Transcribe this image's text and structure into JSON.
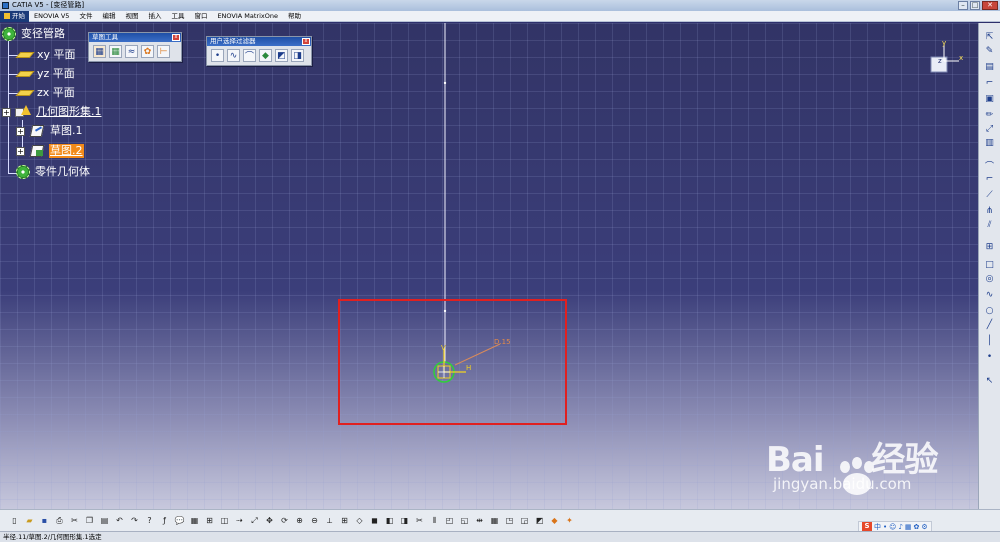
{
  "window": {
    "title": "CATIA V5 - [变径管路]",
    "min_label": "–",
    "max_label": "□",
    "close_label": "✕"
  },
  "menu": {
    "items": [
      {
        "label": "开始"
      },
      {
        "label": "ENOVIA V5"
      },
      {
        "label": "文件"
      },
      {
        "label": "编辑"
      },
      {
        "label": "视图"
      },
      {
        "label": "插入"
      },
      {
        "label": "工具"
      },
      {
        "label": "窗口"
      },
      {
        "label": "ENOVIA MatrixOne"
      },
      {
        "label": "帮助"
      }
    ]
  },
  "tree": {
    "root": "变径管路",
    "planes": [
      "xy 平面",
      "yz 平面",
      "zx 平面"
    ],
    "geoset": "几何图形集.1",
    "sketch1": "草图.1",
    "sketch2": "草图.2",
    "body": "零件几何体",
    "expander_label": "+"
  },
  "toolbars": {
    "sketch_tools": {
      "title": "草图工具",
      "close_label": "x"
    },
    "user_filter": {
      "title": "用户选择过滤器",
      "close_label": "x"
    }
  },
  "sketch": {
    "dimension_label": "D.15",
    "v_axis": "V",
    "h_axis": "H"
  },
  "compass": {
    "x": "x",
    "y": "y",
    "z": "z"
  },
  "status": {
    "text": "半径.11/草图.2/几何图形集.1选定"
  },
  "ime": {
    "s": "S",
    "lang": "中"
  },
  "watermark": {
    "brand": "Bai",
    "suffix": "经验",
    "url": "jingyan.baidu.com"
  },
  "colors": {
    "selection": "#f28a1a",
    "highlight_box": "#e02020",
    "circle": "#2fcf3a",
    "axis": "#f2d21f"
  }
}
